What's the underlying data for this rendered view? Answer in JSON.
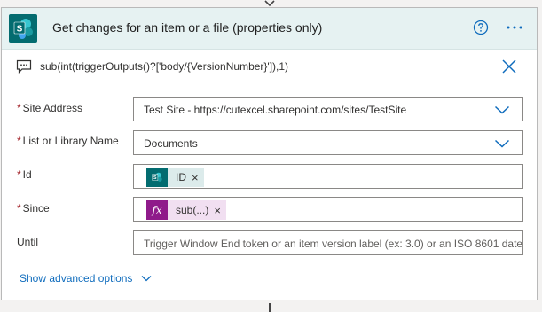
{
  "header": {
    "title": "Get changes for an item or a file (properties only)",
    "accent": "#036c70",
    "icons": [
      "sharepoint-icon",
      "help-icon",
      "more-options-icon"
    ]
  },
  "comment": {
    "text": "sub(int(triggerOutputs()?['body/{VersionNumber}']),1)",
    "icons": [
      "comment-icon",
      "close-icon"
    ]
  },
  "fields": {
    "site_address": {
      "label": "Site Address",
      "required": "*",
      "value": "Test Site - https://cutexcel.sharepoint.com/sites/TestSite"
    },
    "list_name": {
      "label": "List or Library Name",
      "required": "*",
      "value": "Documents"
    },
    "id": {
      "label": "Id",
      "required": "*",
      "token_label": "ID",
      "token_remove": "×"
    },
    "since": {
      "label": "Since",
      "required": "*",
      "token_icon": "fx",
      "token_label": "sub(...)",
      "token_remove": "×"
    },
    "until": {
      "label": "Until",
      "placeholder": "Trigger Window End token or an item version label (ex: 3.0) or an ISO 8601 date"
    }
  },
  "advanced": {
    "label": "Show advanced options"
  }
}
